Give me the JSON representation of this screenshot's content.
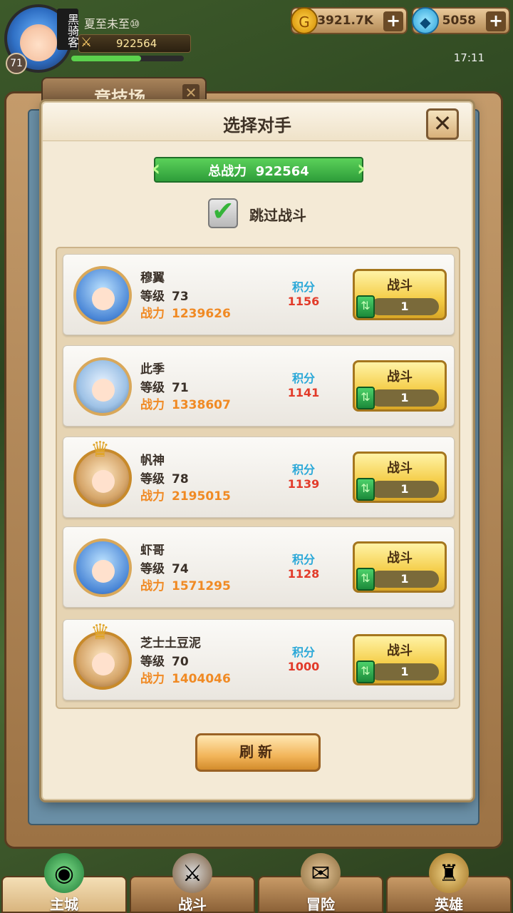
{
  "player": {
    "title_badge": "黑骑客",
    "name": "夏至未至⑩",
    "level": "71",
    "power": "922564"
  },
  "currency": {
    "gold_amount": "3921.7K",
    "gem_amount": "5058",
    "plus_symbol": "+"
  },
  "clock": "17:11",
  "arena": {
    "tab_title": "竞技场"
  },
  "modal": {
    "title": "选择对手",
    "close_symbol": "✕",
    "total_power_label": "总战力",
    "total_power_value": "922564",
    "skip_battle_label": "跳过战斗",
    "skip_battle_checked": true,
    "refresh_label": "刷新"
  },
  "labels": {
    "level": "等级",
    "power": "战力",
    "score": "积分",
    "fight": "战斗"
  },
  "opponents": [
    {
      "name": "穆翼",
      "level": "73",
      "power": "1239626",
      "score": "1156",
      "cost": "1",
      "avatar": "blue-hair-girl",
      "frame": "plain"
    },
    {
      "name": "此季",
      "level": "71",
      "power": "1338607",
      "score": "1141",
      "cost": "1",
      "avatar": "masked-silver-hair",
      "frame": "plain"
    },
    {
      "name": "帆神",
      "level": "78",
      "power": "2195015",
      "score": "1139",
      "cost": "1",
      "avatar": "brown-hair-boy",
      "frame": "crown"
    },
    {
      "name": "虾哥",
      "level": "74",
      "power": "1571295",
      "score": "1128",
      "cost": "1",
      "avatar": "blue-hair-girl",
      "frame": "plain"
    },
    {
      "name": "芝士土豆泥",
      "level": "70",
      "power": "1404046",
      "score": "1000",
      "cost": "1",
      "avatar": "blonde-girl",
      "frame": "crown"
    }
  ],
  "nav": [
    {
      "label": "主城",
      "icon": "city-orb-icon",
      "active": true
    },
    {
      "label": "战斗",
      "icon": "crossed-swords-icon",
      "active": false
    },
    {
      "label": "冒险",
      "icon": "map-scroll-icon",
      "active": false
    },
    {
      "label": "英雄",
      "icon": "hero-shield-icon",
      "active": false
    }
  ],
  "colors": {
    "score_label": "#2aa8d8",
    "score_value": "#e23b2a",
    "power_text": "#f08a24",
    "ribbon_green": "#2e9d3a"
  }
}
